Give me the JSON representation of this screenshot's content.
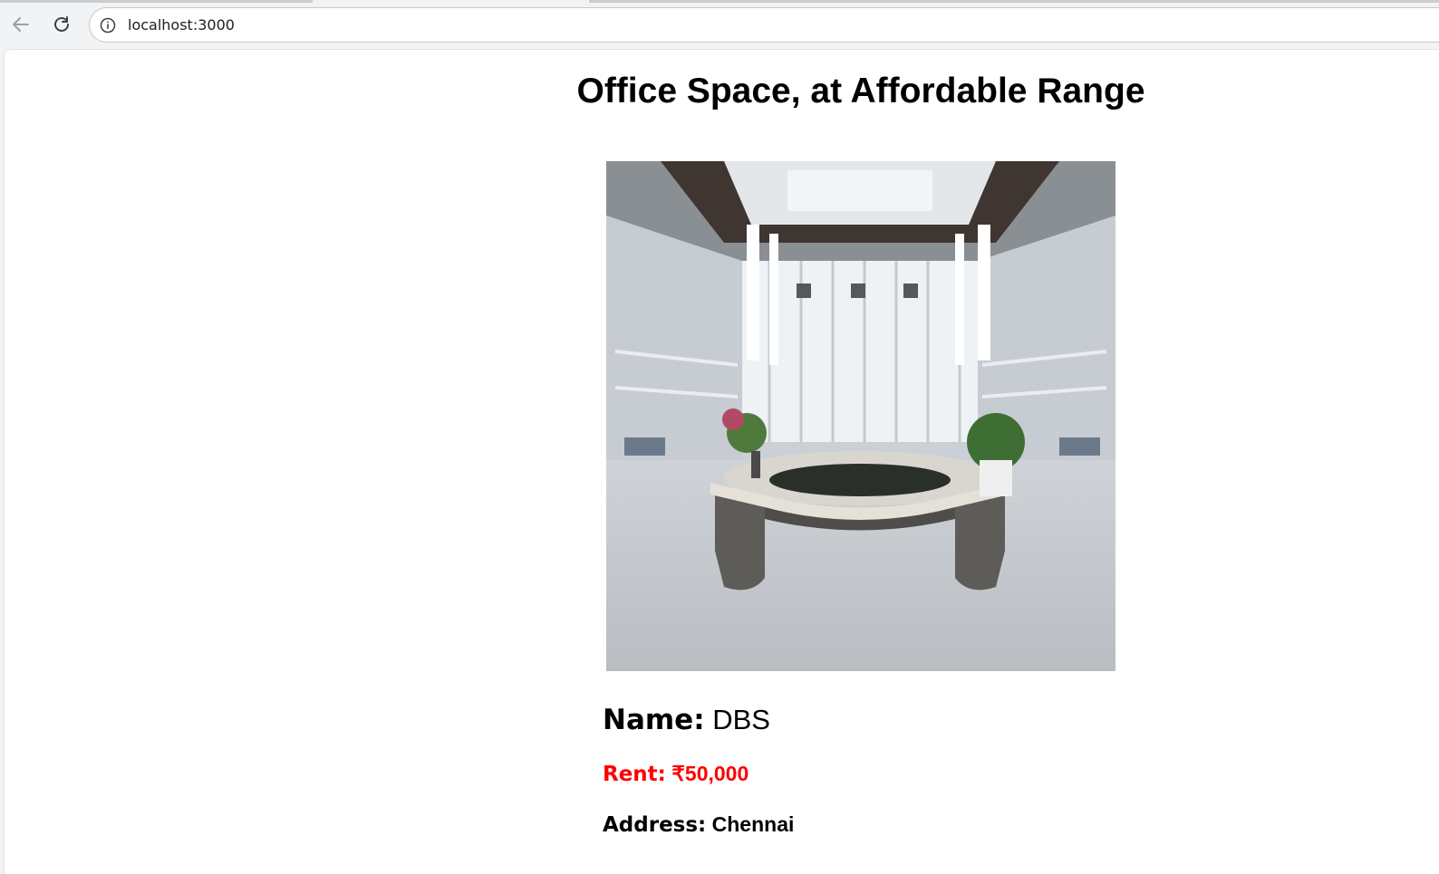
{
  "browser": {
    "url": "localhost:3000"
  },
  "page": {
    "title": "Office Space, at Affordable Range"
  },
  "listing": {
    "name_label": "Name:",
    "name_value": "DBS",
    "rent_label": "Rent:",
    "rent_value": "₹50,000",
    "address_label": "Address:",
    "address_value": "Chennai"
  },
  "colors": {
    "rent": "#ff0000",
    "text": "#000000",
    "chrome_bg": "#f1f3f4"
  }
}
